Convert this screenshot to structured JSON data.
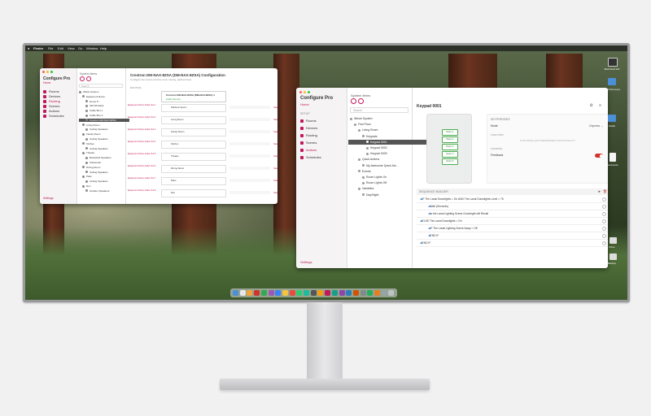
{
  "menubar": {
    "app": "Finder",
    "items": [
      "File",
      "Edit",
      "View",
      "Go",
      "Window",
      "Help"
    ]
  },
  "left_window": {
    "app_title": "Configure Pro",
    "home_label": "Home",
    "sidebar": [
      {
        "label": "Rooms"
      },
      {
        "label": "Devices"
      },
      {
        "label": "Routing"
      },
      {
        "label": "Scenes"
      },
      {
        "label": "Actions"
      },
      {
        "label": "Schedules"
      }
    ],
    "settings_label": "Settings",
    "tree_header": "System Items",
    "search_placeholder": "Search",
    "tree": [
      {
        "label": "Whole System"
      },
      {
        "label": "Equipment Room"
      },
      {
        "label": "Home Ti..."
      },
      {
        "label": "SW-N6 Rack"
      },
      {
        "label": "Cable Box 1"
      },
      {
        "label": "Cable Box 2"
      },
      {
        "label": "Crestron DM-NAX-8ZSA"
      },
      {
        "label": "Living Room"
      },
      {
        "label": "Ceiling Speakers"
      },
      {
        "label": "Family Room"
      },
      {
        "label": "Ceiling Speakers"
      },
      {
        "label": "Kitchen"
      },
      {
        "label": "Ceiling Speakers"
      },
      {
        "label": "Theater"
      },
      {
        "label": "Bookshelf Speakers"
      },
      {
        "label": "Subwoofer"
      },
      {
        "label": "Dining Room"
      },
      {
        "label": "Ceiling Speakers"
      },
      {
        "label": "Patio"
      },
      {
        "label": "Ceiling Speakers"
      },
      {
        "label": "Den"
      },
      {
        "label": "Outdoor Speakers"
      }
    ],
    "main_title": "Crestron DM-NAX-8ZSA (DM-NAX-8ZSA) Configuration",
    "main_subtitle": "Configure the source and the zone routing, patched here.",
    "section": "ROUTING",
    "device_name": "Crestron DM-NAX-8ZSA (DM-NAX-8ZSA) 1",
    "device_sub": "Audio Source",
    "rows": [
      {
        "left": "Equipment Room Audio Out 1",
        "mid": "Patched Input 1",
        "right": "Selected"
      },
      {
        "left": "Equipment Room Audio Out 2",
        "mid": "Living Room",
        "right": "Selected"
      },
      {
        "left": "Equipment Room Audio Out 3",
        "mid": "Family Room",
        "right": "Selected"
      },
      {
        "left": "Equipment Room Audio Out 4",
        "mid": "Kitchen",
        "right": "Selected"
      },
      {
        "left": "Equipment Room Audio Out 5",
        "mid": "Theater",
        "right": "Selected"
      },
      {
        "left": "Equipment Room Audio Out 6",
        "mid": "Dining Room",
        "right": "Selected"
      },
      {
        "left": "Equipment Room Audio Out 7",
        "mid": "Patio",
        "right": "Selected"
      },
      {
        "left": "Equipment Room Audio Out 8",
        "mid": "Den",
        "right": "Selected"
      }
    ]
  },
  "right_window": {
    "app_title": "Configure Pro",
    "home_label": "Home",
    "sidebar_section": "SETUP",
    "sidebar": [
      {
        "label": "Rooms"
      },
      {
        "label": "Devices"
      },
      {
        "label": "Routing"
      },
      {
        "label": "Scenes"
      },
      {
        "label": "Actions"
      },
      {
        "label": "Schedules"
      }
    ],
    "active_sidebar": "Actions",
    "settings_label": "Settings",
    "tree_header": "System Items",
    "search_placeholder": "Search",
    "tree": [
      {
        "label": "Whole System",
        "indent": 0
      },
      {
        "label": "First Floor",
        "indent": 1
      },
      {
        "label": "Living Room",
        "indent": 2
      },
      {
        "label": "Keypads",
        "indent": 3
      },
      {
        "label": "Keypad 0001",
        "indent": 4,
        "selected": true
      },
      {
        "label": "Keypad 0002",
        "indent": 4
      },
      {
        "label": "Keypad 0003",
        "indent": 4
      },
      {
        "label": "Quick Actions",
        "indent": 2
      },
      {
        "label": "My Awesome Quick Act...",
        "indent": 3
      },
      {
        "label": "Events",
        "indent": 2
      },
      {
        "label": "Room Lights On",
        "indent": 3
      },
      {
        "label": "Room Lights Off",
        "indent": 3
      },
      {
        "label": "Variables",
        "indent": 2
      },
      {
        "label": "Day/Night",
        "indent": 3
      }
    ],
    "device_title": "Keypad 0001",
    "keypad_buttons": [
      "Button 1",
      "Button 2",
      "Button 3",
      "Button 4",
      "Button 5"
    ],
    "panel_header": "KEYPRESSES",
    "mode_label": "Mode",
    "mode_value": "Onpress",
    "function_label": "FUNCTION",
    "function_text": "THIS MODE HAS PREDEFINED FUNCTIONALITY",
    "control_label": "CONTROL",
    "feedback_label": "Feedback",
    "sequence_header": "SEQUENCE BUILDER",
    "sequence": [
      {
        "text": "IF The Lanai Downlights = On  AND The Lanai Downlights Level > 75",
        "indent": 0
      },
      {
        "text": "Wait (Seconds)",
        "indent": 1
      },
      {
        "text": "Is the Lanai Lighting Scene Goodnight will Recall",
        "indent": 1
      },
      {
        "text": "ELSE The Lanai Downlights = On",
        "indent": 0
      },
      {
        "text": "IF The Lanai Lighting Scene Away = Off",
        "indent": 1
      },
      {
        "text": "END IF",
        "indent": 1
      },
      {
        "text": "END IF",
        "indent": 0
      }
    ]
  },
  "desktop_icons": [
    {
      "label": "Macintosh HD"
    },
    {
      "label": "MPR Recovery"
    },
    {
      "label": "Folder"
    },
    {
      "label": "Documents"
    },
    {
      "label": "report.pdf"
    },
    {
      "label": "Drive"
    },
    {
      "label": "Backup"
    }
  ]
}
